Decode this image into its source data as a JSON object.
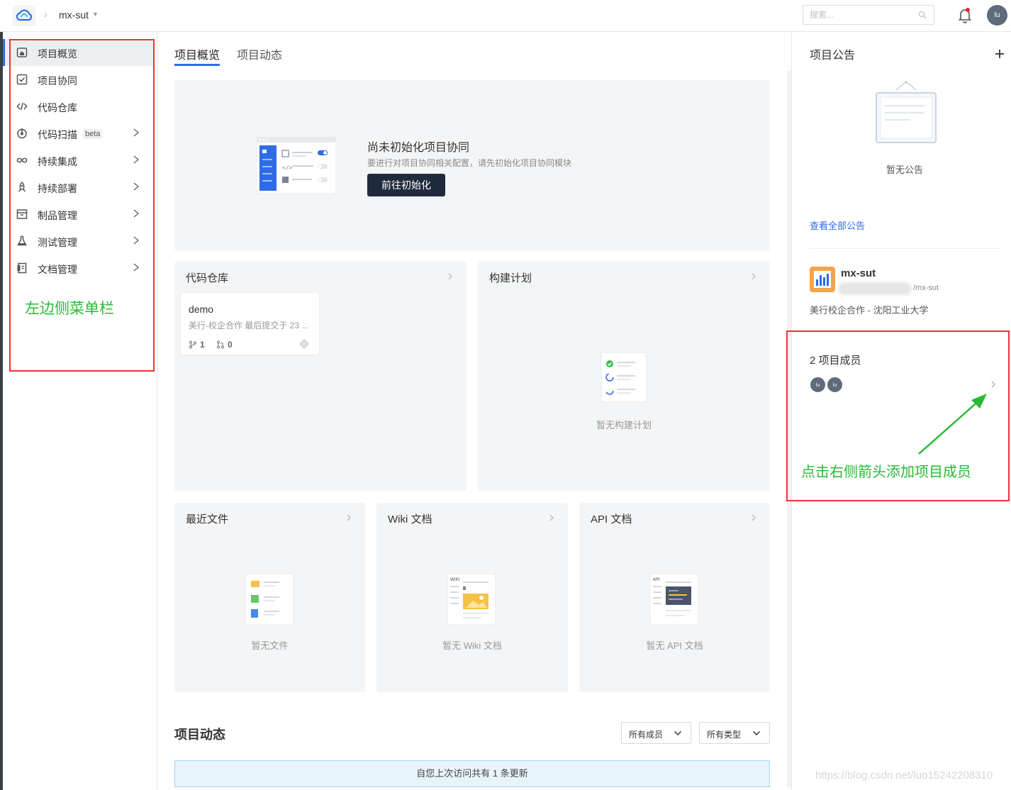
{
  "topbar": {
    "project_name": "mx-sut",
    "search_placeholder": "搜索...",
    "avatar_initials": "lu"
  },
  "sidebar": {
    "items": [
      {
        "label": "项目概览",
        "icon": "home-icon",
        "active": true
      },
      {
        "label": "项目协同",
        "icon": "checkbox-icon"
      },
      {
        "label": "代码仓库",
        "icon": "code-icon"
      },
      {
        "label": "代码扫描",
        "icon": "scan-icon",
        "badge": "beta"
      },
      {
        "label": "持续集成",
        "icon": "infinity-icon"
      },
      {
        "label": "持续部署",
        "icon": "rocket-icon"
      },
      {
        "label": "制品管理",
        "icon": "package-icon"
      },
      {
        "label": "测试管理",
        "icon": "flask-icon"
      },
      {
        "label": "文档管理",
        "icon": "document-icon"
      }
    ],
    "annotation": "左边侧菜单栏"
  },
  "tabs": [
    {
      "label": "项目概览",
      "active": true
    },
    {
      "label": "项目动态"
    }
  ],
  "init_panel": {
    "title": "尚未初始化项目协同",
    "desc": "要进行对项目协同相关配置，请先初始化项目协同模块",
    "button": "前往初始化"
  },
  "repo_panel": {
    "title": "代码仓库",
    "repo": {
      "name": "demo",
      "desc": "美行-校企合作 最后提交于 23 ...",
      "branches": "1",
      "merge_requests": "0"
    }
  },
  "build_panel": {
    "title": "构建计划",
    "empty": "暂无构建计划"
  },
  "files_panel": {
    "title": "最近文件",
    "empty": "暂无文件"
  },
  "wiki_panel": {
    "title": "Wiki 文档",
    "empty": "暂无 Wiki 文档"
  },
  "api_panel": {
    "title": "API 文档",
    "empty": "暂无 API 文档"
  },
  "activity": {
    "title": "项目动态",
    "member_filter": "所有成员",
    "type_filter": "所有类型",
    "update_text": "自您上次访问共有 1 条更新"
  },
  "right": {
    "notice_title": "项目公告",
    "no_notice": "暂无公告",
    "view_all": "查看全部公告",
    "project": {
      "name": "mx-sut",
      "path": "/mx-sut",
      "org": "美行校企合作 - 沈阳工业大学"
    },
    "members_title": "2 项目成员",
    "member_initials": [
      "lu",
      "lu"
    ],
    "annotation": "点击右侧箭头添加项目成员"
  },
  "watermark": "https://blog.csdn.net/luo15242208310",
  "colors": {
    "accent": "#2e6be6",
    "annotation": "#2ab935",
    "highlight_box": "#ee3333",
    "button_dark": "#1f2a3c"
  }
}
